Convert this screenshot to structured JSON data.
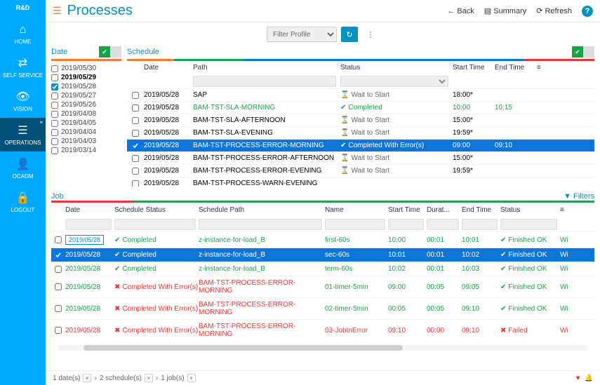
{
  "brand": "R&D",
  "nav": [
    {
      "label": "HOME",
      "icon": "⌂"
    },
    {
      "label": "SELF SERVICE",
      "icon": "⇄"
    },
    {
      "label": "VISION",
      "icon": "👁"
    },
    {
      "label": "OPERATIONS",
      "icon": "☰",
      "active": true
    },
    {
      "label": "OCADM",
      "icon": "👤"
    },
    {
      "label": "LOGOUT",
      "icon": "🔒"
    }
  ],
  "title": "Processes",
  "toolbar": {
    "back": "Back",
    "summary": "Summary",
    "refresh": "Refresh",
    "help": "?"
  },
  "filterbar": {
    "placeholder": "Filter Profile"
  },
  "date_pane": {
    "title": "Date"
  },
  "dates": [
    {
      "d": "2019/05/30"
    },
    {
      "d": "2019/05/29",
      "bold": true
    },
    {
      "d": "2019/05/28",
      "checked": true
    },
    {
      "d": "2019/05/27"
    },
    {
      "d": "2019/05/26"
    },
    {
      "d": "2019/04/08"
    },
    {
      "d": "2019/04/05"
    },
    {
      "d": "2019/04/04"
    },
    {
      "d": "2019/04/03"
    },
    {
      "d": "2019/03/14"
    }
  ],
  "sched_pane": {
    "title": "Schedule"
  },
  "sched_cols": {
    "date": "Date",
    "path": "Path",
    "status": "Status",
    "start": "Start Time",
    "end": "End Time"
  },
  "sched_rows": [
    {
      "date": "2019/05/28",
      "path": "SAP",
      "status": "Wait to Start",
      "sicon": "⌛",
      "scls": "c-gray",
      "start": "18:00*",
      "end": ""
    },
    {
      "date": "2019/05/28",
      "path": "BAM-TST-SLA-MORNING",
      "pcls": "c-green",
      "status": "Completed",
      "sicon": "✔",
      "scls": "c-green",
      "start": "10:00",
      "end": "10:15",
      "tcls": "c-green"
    },
    {
      "date": "2019/05/28",
      "path": "BAM-TST-SLA-AFTERNOON",
      "status": "Wait to Start",
      "sicon": "⌛",
      "scls": "c-gray",
      "start": "15:00*",
      "end": ""
    },
    {
      "date": "2019/05/28",
      "path": "BAM-TST-SLA-EVENING",
      "status": "Wait to Start",
      "sicon": "⌛",
      "scls": "c-gray",
      "start": "19:59*",
      "end": ""
    },
    {
      "date": "2019/05/28",
      "path": "BAM-TST-PROCESS-ERROR-MORNING",
      "status": "Completed With Error(s)",
      "sicon": "✔",
      "start": "09:00",
      "end": "09:10",
      "selected": true
    },
    {
      "date": "2019/05/28",
      "path": "BAM-TST-PROCESS-ERROR-AFTERNOON",
      "status": "Wait to Start",
      "sicon": "⌛",
      "scls": "c-gray",
      "start": "15:00*",
      "end": ""
    },
    {
      "date": "2019/05/28",
      "path": "BAM-TST-PROCESS-ERROR-EVENING",
      "status": "Wait to Start",
      "sicon": "⌛",
      "scls": "c-gray",
      "start": "19:59*",
      "end": ""
    },
    {
      "date": "2019/05/28",
      "path": "BAM-TST-PROCESS-WARN-EVENING",
      "status": "",
      "sicon": "",
      "scls": "c-gray",
      "start": "",
      "end": ""
    }
  ],
  "job_pane": {
    "title": "Job",
    "filters": "Filters"
  },
  "job_cols": {
    "date": "Date",
    "sstatus": "Schedule Status",
    "spath": "Schedule Path",
    "name": "Name",
    "start": "Start Time",
    "dur": "Durat...",
    "end": "End Time",
    "status": "Status"
  },
  "job_rows": [
    {
      "date": "2019/05/28",
      "dbox": true,
      "sstatus": "Completed",
      "sicon": "✔",
      "scls": "c-green",
      "spath": "z-instance-for-load_B",
      "pcls": "c-green",
      "name": "first-60s",
      "ncls": "c-green",
      "start": "10:00",
      "dur": "00:01",
      "end": "10:01",
      "status": "Finished OK",
      "stcls": "c-green",
      "sticon": "✔",
      "trail": "Wi"
    },
    {
      "date": "2019/05/28",
      "sstatus": "Completed",
      "sicon": "✔",
      "spath": "z-instance-for-load_B",
      "name": "sec-60s",
      "start": "10:01",
      "dur": "00:01",
      "end": "10:02",
      "status": "Finished OK",
      "sticon": "✔",
      "selected": true,
      "trail": "Wi"
    },
    {
      "date": "2019/05/28",
      "sstatus": "Completed",
      "sicon": "✔",
      "scls": "c-green",
      "spath": "z-instance-for-load_B",
      "pcls": "c-green",
      "name": "term-60s",
      "ncls": "c-green",
      "start": "10:02",
      "dur": "00:01",
      "end": "10:03",
      "status": "Finished OK",
      "stcls": "c-green",
      "sticon": "✔",
      "trail": "Wi"
    },
    {
      "date": "2019/05/28",
      "sstatus": "Completed With Error(s)",
      "sicon": "✖",
      "scls": "c-red",
      "spath": "BAM-TST-PROCESS-ERROR-MORNING",
      "pcls": "c-red",
      "name": "01-timer-5min",
      "ncls": "c-green",
      "start": "09:00",
      "dur": "00:05",
      "end": "09:05",
      "status": "Finished OK",
      "stcls": "c-green",
      "sticon": "✔",
      "trail": "Wi"
    },
    {
      "date": "2019/05/28",
      "sstatus": "Completed With Error(s)",
      "sicon": "✖",
      "scls": "c-red",
      "spath": "BAM-TST-PROCESS-ERROR-MORNING",
      "pcls": "c-red",
      "name": "02-timer-5min",
      "ncls": "c-green",
      "start": "00:05",
      "dur": "00:05",
      "end": "09:10",
      "status": "Finished OK",
      "stcls": "c-green",
      "sticon": "✔",
      "trail": "Wi"
    },
    {
      "date": "2019/05/28",
      "dcls": "c-red",
      "sstatus": "Completed With Error(s)",
      "sicon": "✖",
      "scls": "c-red",
      "spath": "BAM-TST-PROCESS-ERROR-MORNING",
      "pcls": "c-red",
      "name": "03-JobInError",
      "ncls": "c-red",
      "start": "09:10",
      "dur": "00:00",
      "end": "09:10",
      "status": "Failed",
      "stcls": "c-red",
      "sticon": "✖",
      "trail": "Wi"
    }
  ],
  "breadcrumb": {
    "d": "1 date(s)",
    "s": "2 schedule(s)",
    "j": "1 job(s)"
  }
}
